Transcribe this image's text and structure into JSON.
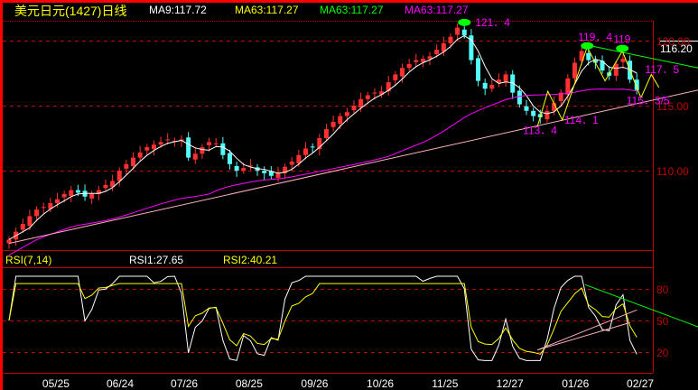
{
  "header": {
    "title": "美元日元(1427)日线",
    "ma9": "MA9:117.72",
    "ma63_yellow": "MA63:117.27",
    "ma63_green": "MA63:117.27",
    "ma63_magenta": "MA63:117.27"
  },
  "rsi_header": {
    "name": "RSI(7,14)",
    "rsi1": "RSI1:27.65",
    "rsi2": "RSI2:40.21"
  },
  "colors": {
    "up": "#ff3030",
    "down": "#54fcfc",
    "ma_short": "#ffffff",
    "ma_long": "#ff00ff",
    "support": "#ffb0c0",
    "resistance": "#00ff00",
    "forecast": "#ffff00",
    "axis": "#c00000",
    "annotation": "#ff00ff"
  },
  "chart_data": [
    {
      "type": "candlestick",
      "title": "美元日元(1427)日线",
      "current_price": "116.20",
      "ylim": [
        103.8,
        122.3
      ],
      "y_ticks": [
        "120.00",
        "115.00",
        "110.00"
      ],
      "y_tick_values": [
        120,
        115,
        110
      ],
      "x_ticks": [
        "05/25",
        "06/24",
        "07/26",
        "08/25",
        "09/26",
        "10/26",
        "11/25",
        "12/27",
        "01/26",
        "02/27"
      ],
      "x_tick_index": [
        6.8,
        16.1,
        25.4,
        34.8,
        44.3,
        53.8,
        63.2,
        72.6,
        82.1,
        91.5
      ],
      "close": [
        104.7,
        105.3,
        105.9,
        106.5,
        107.0,
        107.2,
        107.5,
        107.8,
        108.2,
        108.5,
        108.3,
        108.0,
        108.2,
        108.5,
        108.9,
        109.2,
        110.0,
        110.5,
        111.0,
        111.4,
        111.8,
        112.0,
        112.2,
        112.4,
        112.3,
        112.4,
        111.0,
        111.3,
        111.8,
        112.2,
        112.1,
        111.2,
        110.5,
        110.0,
        110.2,
        110.4,
        110.0,
        109.8,
        109.6,
        109.8,
        110.3,
        110.7,
        111.2,
        111.7,
        111.8,
        112.5,
        113.2,
        113.75,
        114.2,
        114.5,
        115.0,
        115.5,
        115.8,
        116.0,
        116.1,
        116.8,
        117.4,
        117.9,
        118.2,
        118.5,
        118.6,
        118.8,
        119.3,
        119.8,
        120.3,
        121.0,
        120.4,
        118.5,
        116.9,
        116.3,
        116.6,
        117.0,
        117.4,
        116.0,
        115.1,
        114.6,
        114.2,
        114.1,
        114.6,
        115.2,
        116.0,
        117.1,
        118.3,
        119.2,
        118.5,
        118.3,
        117.7,
        117.3,
        118.2,
        118.6,
        117.0,
        116.2
      ],
      "trendlines": [
        {
          "name": "support",
          "from": [
            0,
            104.4
          ],
          "to": [
            99.9,
            116.2
          ]
        },
        {
          "name": "resistance",
          "from": [
            83.8,
            119.65
          ],
          "to": [
            99.9,
            117.9
          ]
        }
      ],
      "forecast_path": [
        [
          76.6,
          113.4
        ],
        [
          78.1,
          116.1
        ],
        [
          80.2,
          113.9
        ],
        [
          83.8,
          119.5
        ],
        [
          86.4,
          116.9
        ],
        [
          88.9,
          119.2
        ],
        [
          91.6,
          115.6
        ],
        [
          93.1,
          117.4
        ],
        [
          94.2,
          116.4
        ]
      ],
      "annotations": [
        {
          "text": "121．4",
          "at": [
            66.0,
            121.4
          ],
          "marker": true
        },
        {
          "text": "119．4",
          "at": [
            83.8,
            119.6
          ],
          "marker": true
        },
        {
          "text": "119",
          "at": [
            88.9,
            119.4
          ],
          "marker": true
        },
        {
          "text": "117．5",
          "at": [
            92.2,
            117.5
          ],
          "marker": false
        },
        {
          "text": "115．3/5",
          "at": [
            89.5,
            115.1
          ],
          "marker": false
        },
        {
          "text": "114．1",
          "at": [
            80.5,
            113.6
          ],
          "marker": false
        },
        {
          "text": "113．4",
          "at": [
            74.5,
            112.8
          ],
          "marker": false
        }
      ]
    },
    {
      "type": "line",
      "title": "RSI(7,14)",
      "ylim": [
        0,
        100
      ],
      "y_ticks": [
        "80",
        "50",
        "20"
      ],
      "y_tick_values": [
        80,
        50,
        20
      ],
      "series": [
        {
          "name": "RSI1",
          "period": 3
        },
        {
          "name": "RSI2",
          "period": 6
        }
      ]
    }
  ]
}
